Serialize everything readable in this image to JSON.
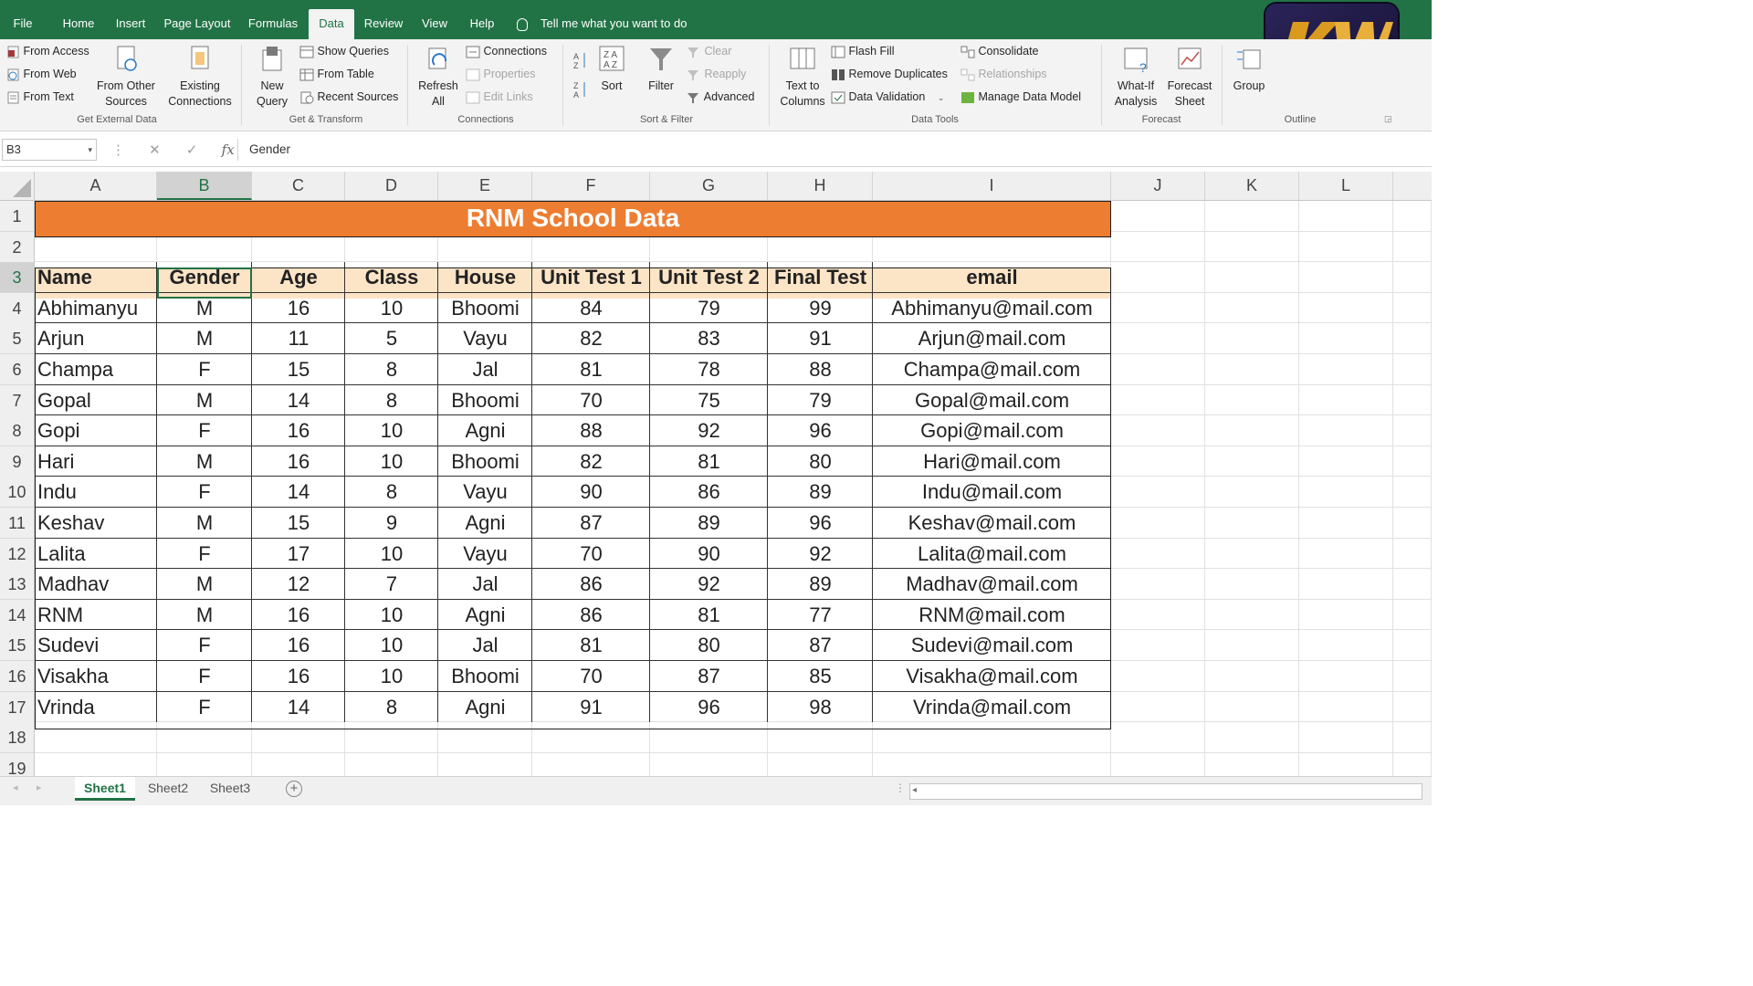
{
  "tabs": [
    "File",
    "Home",
    "Insert",
    "Page Layout",
    "Formulas",
    "Data",
    "Review",
    "View",
    "Help"
  ],
  "active_tab": "Data",
  "tell_me": "Tell me what you want to do",
  "ribbon": {
    "get_external": {
      "from_access": "From Access",
      "from_web": "From Web",
      "from_text": "From Text",
      "from_other_1": "From Other",
      "from_other_2": "Sources",
      "existing_1": "Existing",
      "existing_2": "Connections",
      "label": "Get External Data"
    },
    "get_transform": {
      "new_query_1": "New",
      "new_query_2": "Query",
      "show_queries": "Show Queries",
      "from_table": "From Table",
      "recent_sources": "Recent Sources",
      "label": "Get & Transform"
    },
    "connections": {
      "refresh_1": "Refresh",
      "refresh_2": "All",
      "connections": "Connections",
      "properties": "Properties",
      "edit_links": "Edit Links",
      "label": "Connections"
    },
    "sort_filter": {
      "sort": "Sort",
      "filter": "Filter",
      "clear": "Clear",
      "reapply": "Reapply",
      "advanced": "Advanced",
      "label": "Sort & Filter"
    },
    "data_tools": {
      "text_to_1": "Text to",
      "text_to_2": "Columns",
      "flash_fill": "Flash Fill",
      "remove_duplicates": "Remove Duplicates",
      "data_validation": "Data Validation",
      "consolidate": "Consolidate",
      "relationships": "Relationships",
      "manage_data_model": "Manage Data Model",
      "label": "Data Tools"
    },
    "forecast": {
      "whatif_1": "What-If",
      "whatif_2": "Analysis",
      "forecast_1": "Forecast",
      "forecast_2": "Sheet",
      "label": "Forecast"
    },
    "outline": {
      "group": "Group",
      "label": "Outline"
    }
  },
  "formula_bar": {
    "name_box": "B3",
    "fx": "fx",
    "formula": "Gender"
  },
  "columns": [
    "A",
    "B",
    "C",
    "D",
    "E",
    "F",
    "G",
    "H",
    "I",
    "J",
    "K",
    "L"
  ],
  "rows": [
    "1",
    "2",
    "3",
    "4",
    "5",
    "6",
    "7",
    "8",
    "9",
    "10",
    "11",
    "12",
    "13",
    "14",
    "15",
    "16",
    "17",
    "18",
    "19"
  ],
  "sheet_title": "RNM School Data",
  "headers": [
    "Name",
    "Gender",
    "Age",
    "Class",
    "House",
    "Unit Test 1",
    "Unit Test 2",
    "Final Test",
    "email"
  ],
  "records": [
    [
      "Abhimanyu",
      "M",
      "16",
      "10",
      "Bhoomi",
      "84",
      "79",
      "99",
      "Abhimanyu@mail.com"
    ],
    [
      "Arjun",
      "M",
      "11",
      "5",
      "Vayu",
      "82",
      "83",
      "91",
      "Arjun@mail.com"
    ],
    [
      "Champa",
      "F",
      "15",
      "8",
      "Jal",
      "81",
      "78",
      "88",
      "Champa@mail.com"
    ],
    [
      "Gopal",
      "M",
      "14",
      "8",
      "Bhoomi",
      "70",
      "75",
      "79",
      "Gopal@mail.com"
    ],
    [
      "Gopi",
      "F",
      "16",
      "10",
      "Agni",
      "88",
      "92",
      "96",
      "Gopi@mail.com"
    ],
    [
      "Hari",
      "M",
      "16",
      "10",
      "Bhoomi",
      "82",
      "81",
      "80",
      "Hari@mail.com"
    ],
    [
      "Indu",
      "F",
      "14",
      "8",
      "Vayu",
      "90",
      "86",
      "89",
      "Indu@mail.com"
    ],
    [
      "Keshav",
      "M",
      "15",
      "9",
      "Agni",
      "87",
      "89",
      "96",
      "Keshav@mail.com"
    ],
    [
      "Lalita",
      "F",
      "17",
      "10",
      "Vayu",
      "70",
      "90",
      "92",
      "Lalita@mail.com"
    ],
    [
      "Madhav",
      "M",
      "12",
      "7",
      "Jal",
      "86",
      "92",
      "89",
      "Madhav@mail.com"
    ],
    [
      "RNM",
      "M",
      "16",
      "10",
      "Agni",
      "86",
      "81",
      "77",
      "RNM@mail.com"
    ],
    [
      "Sudevi",
      "F",
      "16",
      "10",
      "Jal",
      "81",
      "80",
      "87",
      "Sudevi@mail.com"
    ],
    [
      "Visakha",
      "F",
      "16",
      "10",
      "Bhoomi",
      "70",
      "87",
      "85",
      "Visakha@mail.com"
    ],
    [
      "Vrinda",
      "F",
      "14",
      "8",
      "Agni",
      "91",
      "96",
      "98",
      "Vrinda@mail.com"
    ]
  ],
  "sheets": [
    "Sheet1",
    "Sheet2",
    "Sheet3"
  ],
  "active_sheet": "Sheet1",
  "colors": {
    "excel_green": "#217346",
    "title_fill": "#ed7d31",
    "header_fill": "#fce4c6"
  }
}
